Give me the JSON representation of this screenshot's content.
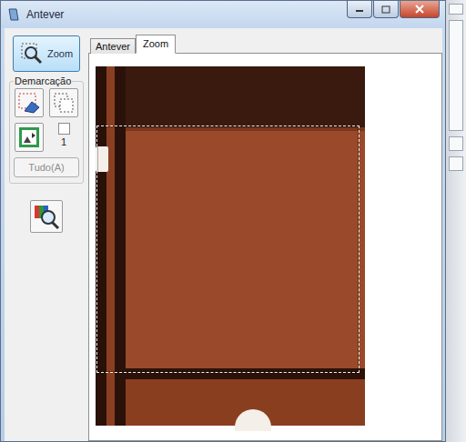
{
  "window": {
    "title": "Antever"
  },
  "zoom_button": {
    "label": "Zoom",
    "selected": true
  },
  "marquee": {
    "label": "Demarcação",
    "count": "1",
    "checked": false
  },
  "all_button": {
    "label": "Tudo(A)",
    "disabled": true
  },
  "tabs": [
    {
      "label": "Antever",
      "selected": false
    },
    {
      "label": "Zoom",
      "selected": true
    }
  ]
}
